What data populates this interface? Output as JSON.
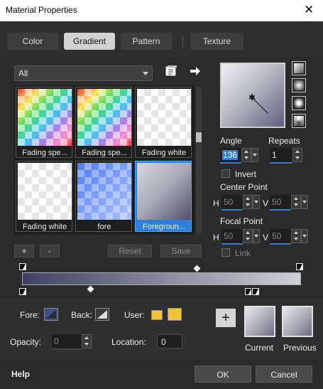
{
  "window": {
    "title": "Material Properties"
  },
  "tabs": [
    {
      "label": "Color"
    },
    {
      "label": "Gradient"
    },
    {
      "label": "Pattern"
    },
    {
      "label": "Texture"
    }
  ],
  "filter": {
    "selected": "All"
  },
  "gradients": [
    {
      "label": "Fading spe..."
    },
    {
      "label": "Fading spe..."
    },
    {
      "label": "Fading white"
    },
    {
      "label": "Fading white"
    },
    {
      "label": "fore"
    },
    {
      "label": "Foregroun..."
    }
  ],
  "list_buttons": {
    "add": "+",
    "remove": "-",
    "reset": "Reset",
    "save": "Save"
  },
  "angle": {
    "label": "Angle",
    "value": "136"
  },
  "repeats": {
    "label": "Repeats",
    "value": "1"
  },
  "invert": {
    "label": "Invert",
    "checked": false
  },
  "center_point": {
    "label": "Center Point",
    "h_label": "H",
    "h_value": "50",
    "v_label": "V",
    "v_value": "50"
  },
  "focal_point": {
    "label": "Focal Point",
    "h_label": "H",
    "h_value": "50",
    "v_label": "V",
    "v_value": "50"
  },
  "link": {
    "label": "Link",
    "checked": false
  },
  "gradient_type_icons": [
    "linear-gradient-icon",
    "rectangular-gradient-icon",
    "sunburst-gradient-icon",
    "radial-gradient-icon"
  ],
  "materials": {
    "fore_label": "Fore:",
    "back_label": "Back:",
    "user_label": "User:",
    "user_color": "#f1c232",
    "opacity_label": "Opacity:",
    "opacity_value": "0",
    "location_label": "Location:",
    "location_value": "0",
    "current_label": "Current",
    "previous_label": "Previous",
    "add_icon": "+"
  },
  "footer": {
    "help": "Help",
    "ok": "OK",
    "cancel": "Cancel"
  },
  "colors": {
    "accent": "#2f7fd8",
    "selected_item": "#2f7fd8",
    "gradient_start": "#3f4161",
    "gradient_end": "#cfcfd6"
  }
}
